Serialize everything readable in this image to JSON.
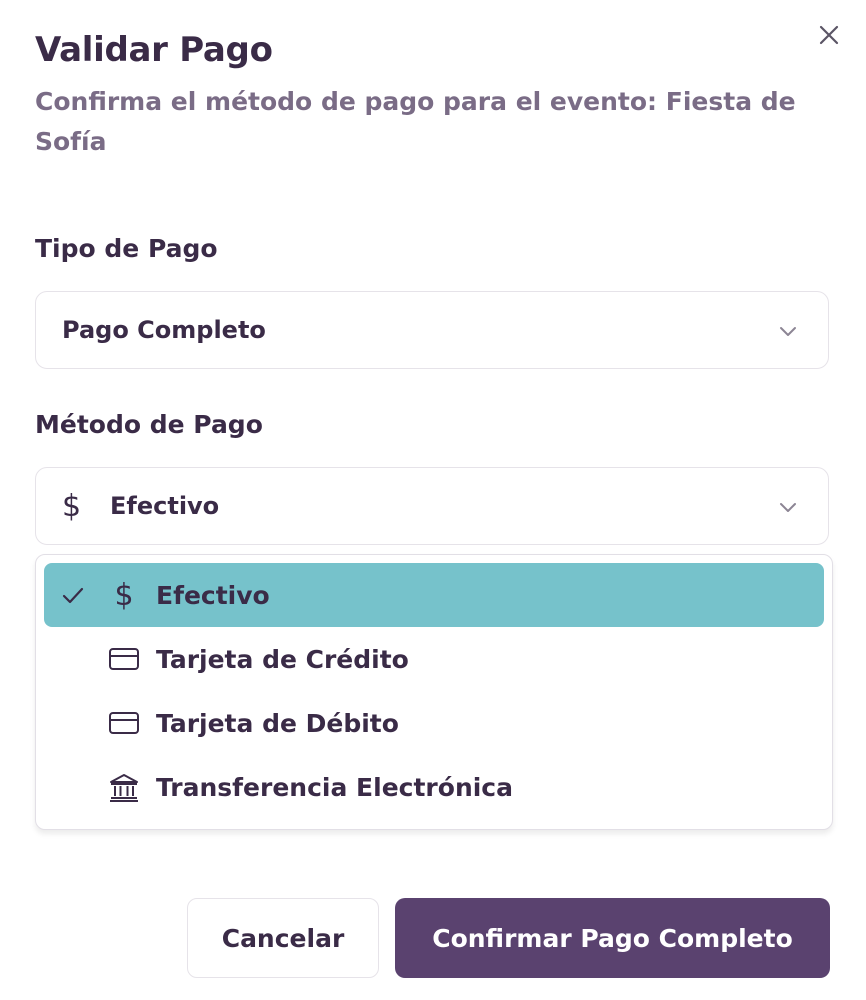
{
  "dialog": {
    "title": "Validar Pago",
    "subtitle": "Confirma el método de pago para el evento: Fiesta de Sofía",
    "close_icon": "close-icon"
  },
  "payment_type": {
    "label": "Tipo de Pago",
    "selected": "Pago Completo"
  },
  "payment_method": {
    "label": "Método de Pago",
    "selected": "Efectivo",
    "selected_icon": "dollar-icon",
    "options": [
      {
        "label": "Efectivo",
        "icon": "dollar-icon",
        "selected": true
      },
      {
        "label": "Tarjeta de Crédito",
        "icon": "credit-card-icon",
        "selected": false
      },
      {
        "label": "Tarjeta de Débito",
        "icon": "credit-card-icon",
        "selected": false
      },
      {
        "label": "Transferencia Electrónica",
        "icon": "bank-icon",
        "selected": false
      }
    ]
  },
  "actions": {
    "cancel_label": "Cancelar",
    "confirm_label": "Confirmar Pago Completo"
  },
  "colors": {
    "primary": "#5a426f",
    "selected_option": "#76c2cb",
    "text": "#3a2b47",
    "muted_text": "#7a6c86"
  }
}
